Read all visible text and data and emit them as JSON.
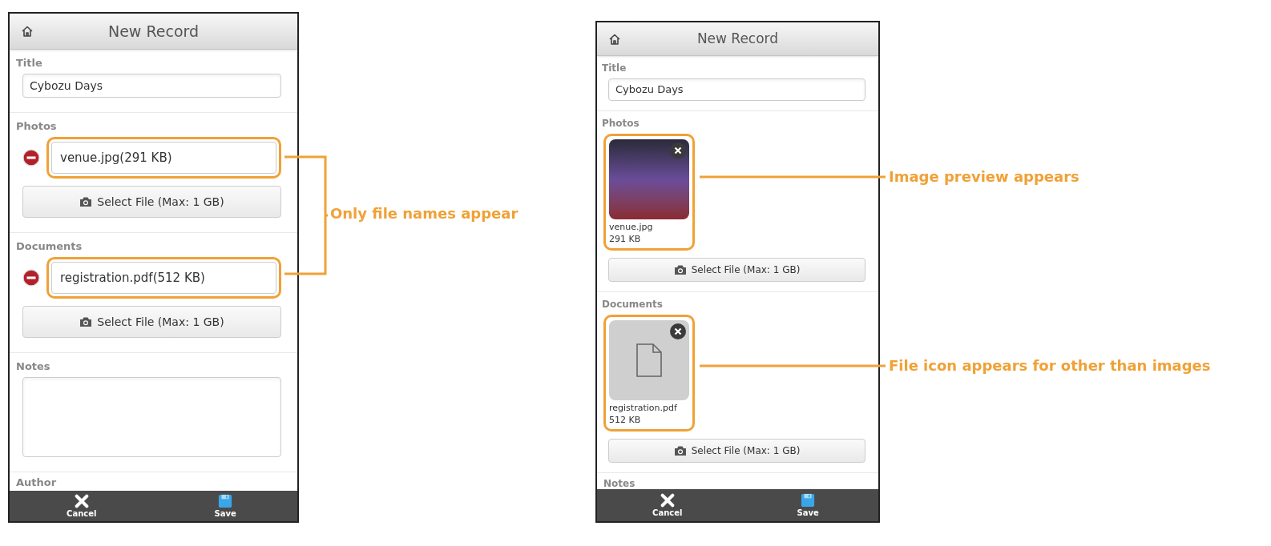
{
  "screens": [
    {
      "header": {
        "title": "New Record"
      },
      "fields": [
        {
          "kind": "text",
          "label": "Title",
          "value": "Cybozu Days"
        },
        {
          "kind": "attachment",
          "label": "Photos",
          "files": [
            {
              "kind": "name_only",
              "name": "venue.jpg(291 KB)"
            }
          ],
          "button": "Select File (Max: 1 GB)"
        },
        {
          "kind": "attachment",
          "label": "Documents",
          "files": [
            {
              "kind": "name_only",
              "name": "registration.pdf(512 KB)"
            }
          ],
          "button": "Select File (Max: 1 GB)"
        },
        {
          "kind": "textarea",
          "label": "Notes"
        },
        {
          "kind": "cut_off",
          "label": "Author"
        }
      ],
      "footer": [
        {
          "kind": "cancel",
          "label": "Cancel"
        },
        {
          "kind": "save",
          "label": "Save"
        }
      ]
    },
    {
      "header": {
        "title": "New Record"
      },
      "fields": [
        {
          "kind": "text",
          "label": "Title",
          "value": "Cybozu Days"
        },
        {
          "kind": "attachment",
          "label": "Photos",
          "files": [
            {
              "kind": "image",
              "name": "venue.jpg",
              "size": "291 KB"
            }
          ],
          "button": "Select File (Max: 1 GB)"
        },
        {
          "kind": "attachment",
          "label": "Documents",
          "files": [
            {
              "kind": "document",
              "name": "registration.pdf",
              "size": "512 KB"
            }
          ],
          "button": "Select File (Max: 1 GB)"
        },
        {
          "kind": "cut_off",
          "label": "Notes"
        }
      ],
      "footer": [
        {
          "kind": "cancel",
          "label": "Cancel"
        },
        {
          "kind": "save",
          "label": "Save"
        }
      ]
    }
  ],
  "callouts": [
    {
      "text": "Only file names appear"
    },
    {
      "text": "Image preview appears"
    },
    {
      "text": "File icon appears for other than images"
    }
  ]
}
